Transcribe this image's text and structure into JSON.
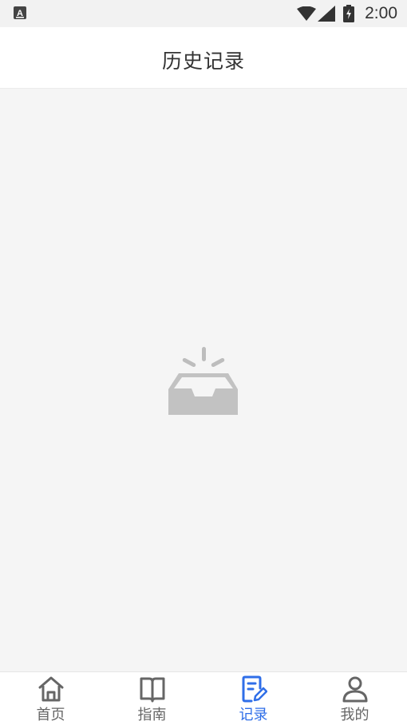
{
  "status_bar": {
    "time": "2:00",
    "icons": [
      "a-icon",
      "wifi-icon",
      "signal-icon",
      "battery-icon"
    ]
  },
  "header": {
    "title": "历史记录"
  },
  "content": {
    "empty_icon": "empty-inbox-icon"
  },
  "tabbar": {
    "active_color": "#2f6ee8",
    "inactive_color": "#666666",
    "tabs": [
      {
        "label": "首页",
        "icon": "home-icon",
        "active": false
      },
      {
        "label": "指南",
        "icon": "book-icon",
        "active": false
      },
      {
        "label": "记录",
        "icon": "record-icon",
        "active": true
      },
      {
        "label": "我的",
        "icon": "user-icon",
        "active": false
      }
    ]
  }
}
